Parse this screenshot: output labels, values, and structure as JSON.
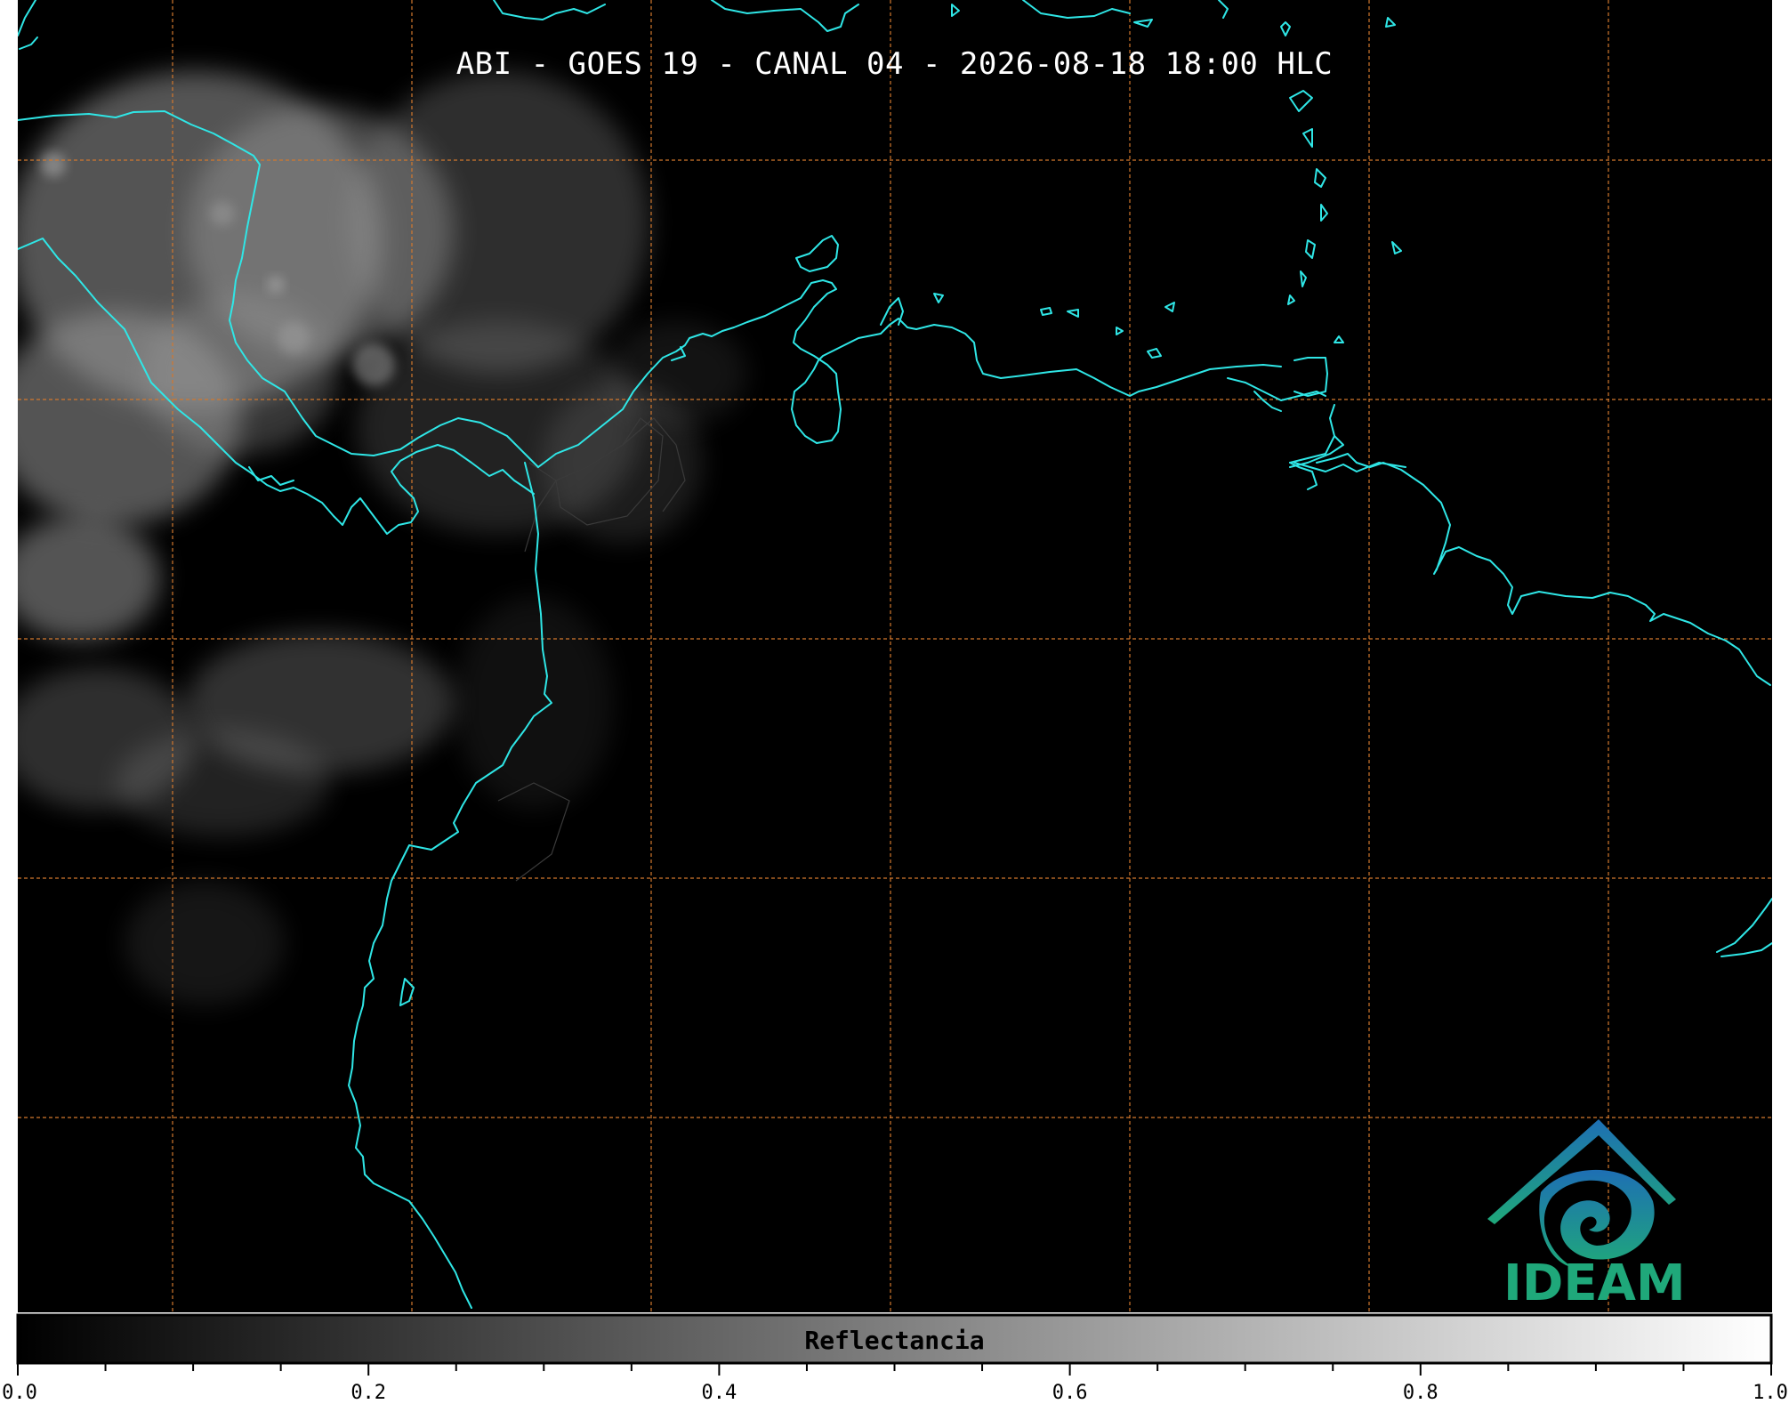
{
  "title": "ABI - GOES 19 - CANAL 04 - 2026-08-18 18:00 HLC",
  "colorbar": {
    "label": "Reflectancia",
    "ticks": [
      "0.0",
      "0.2",
      "0.4",
      "0.6",
      "0.8",
      "1.0"
    ],
    "tick_values": [
      0.0,
      0.2,
      0.4,
      0.6,
      0.8,
      1.0
    ],
    "minor_step": 0.05,
    "gradient_from": "#000000",
    "gradient_to": "#ffffff"
  },
  "map": {
    "background": "#000000",
    "coastline_color": "#2fe6e6",
    "border_color": "#3a3a3a",
    "graticule_color": "#d2782d",
    "cloud_color": "#9a9a9a"
  },
  "logo": {
    "text": "IDEAM",
    "color_top": "#1e6fb4",
    "color_bottom": "#1fa87a"
  }
}
